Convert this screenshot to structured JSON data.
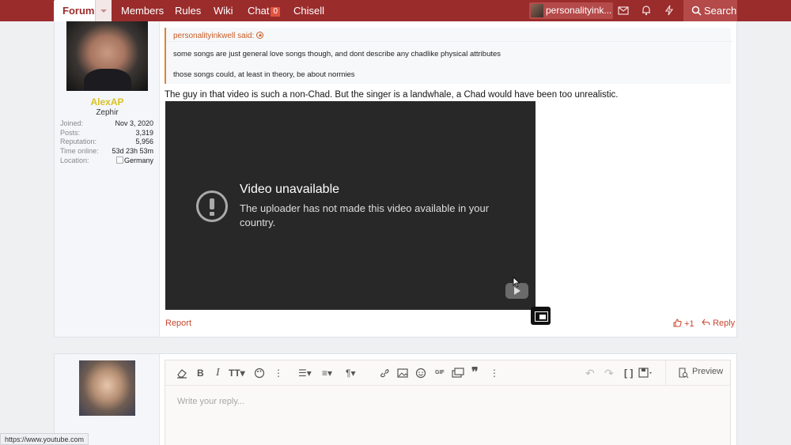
{
  "nav": {
    "tabs": [
      "Forums",
      "Members",
      "Rules",
      "Wiki",
      "Chat",
      "Chisell"
    ],
    "chat_badge": "0",
    "user_name": "personalityink...",
    "search_label": "Search",
    "bg_color": "#9b2c2c"
  },
  "author": {
    "name": "AlexAP",
    "title": "Zephir",
    "stats": [
      {
        "label": "Joined:",
        "value": "Nov 3, 2020"
      },
      {
        "label": "Posts:",
        "value": "3,319"
      },
      {
        "label": "Reputation:",
        "value": "5,956"
      },
      {
        "label": "Time online:",
        "value": "53d 23h 53m"
      },
      {
        "label": "Location:",
        "value": "Germany"
      }
    ]
  },
  "quote": {
    "author_said": "personalityinkwell said:",
    "lines": [
      "some songs are just general love songs though, and dont describe any chadlike physical attributes",
      "those songs could, at least in theory, be about normies"
    ]
  },
  "post": {
    "text": "The guy in that video is such a non-Chad. But the singer is a landwhale, a Chad would have been too unrealistic.",
    "video_title": "Video unavailable",
    "video_message": "The uploader has not made this video available in your country.",
    "report_label": "Report",
    "like_count": "+1",
    "reply_label": "Reply"
  },
  "editor": {
    "placeholder": "Write your reply...",
    "preview_label": "Preview"
  },
  "status_url": "https://www.youtube.com"
}
